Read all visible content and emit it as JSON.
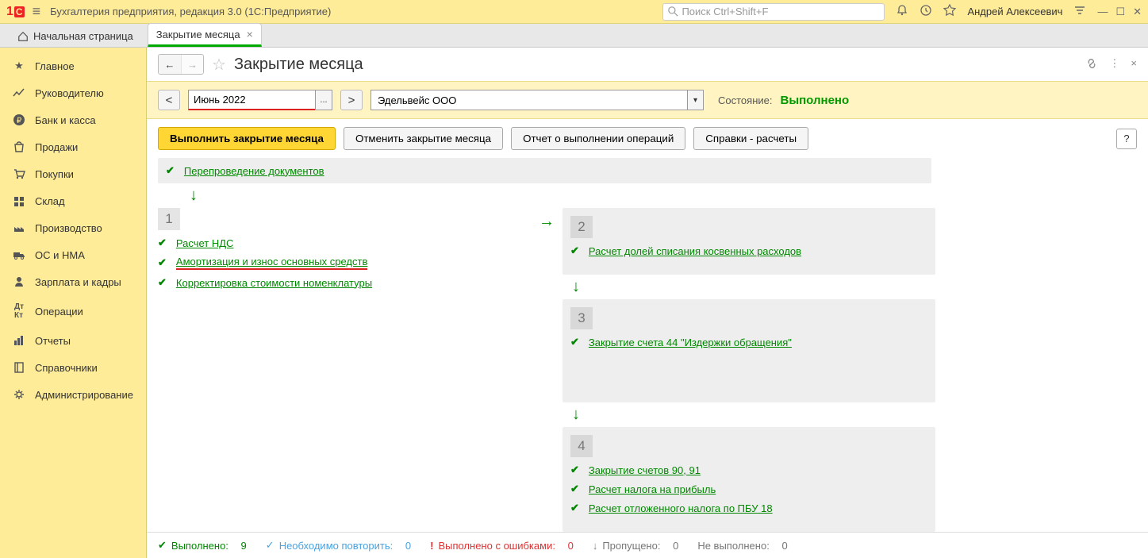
{
  "app_title": "Бухгалтерия предприятия, редакция 3.0  (1С:Предприятие)",
  "search_placeholder": "Поиск Ctrl+Shift+F",
  "user": "Андрей Алексеевич",
  "tabs": {
    "home": "Начальная страница",
    "active": "Закрытие месяца"
  },
  "sidebar": {
    "items": [
      {
        "label": "Главное"
      },
      {
        "label": "Руководителю"
      },
      {
        "label": "Банк и касса"
      },
      {
        "label": "Продажи"
      },
      {
        "label": "Покупки"
      },
      {
        "label": "Склад"
      },
      {
        "label": "Производство"
      },
      {
        "label": "ОС и НМА"
      },
      {
        "label": "Зарплата и кадры"
      },
      {
        "label": "Операции"
      },
      {
        "label": "Отчеты"
      },
      {
        "label": "Справочники"
      },
      {
        "label": "Администрирование"
      }
    ]
  },
  "page": {
    "title": "Закрытие месяца",
    "period": "Июнь 2022",
    "org": "Эдельвейс ООО",
    "state_label": "Состояние:",
    "state_value": "Выполнено"
  },
  "actions": {
    "run": "Выполнить закрытие месяца",
    "cancel": "Отменить закрытие месяца",
    "report": "Отчет о выполнении операций",
    "refs": "Справки - расчеты"
  },
  "ops": {
    "reproc": "Перепроведение документов",
    "b1": {
      "nds": "Расчет НДС",
      "amort": "Амортизация и износ основных средств",
      "korr": "Корректировка стоимости номенклатуры"
    },
    "b2": {
      "doli": "Расчет долей списания косвенных расходов"
    },
    "b3": {
      "acc44": "Закрытие счета 44 \"Издержки обращения\""
    },
    "b4": {
      "acc9091": "Закрытие счетов 90, 91",
      "tax": "Расчет налога на прибыль",
      "pbu18": "Расчет отложенного налога по ПБУ 18"
    }
  },
  "status": {
    "done_label": "Выполнено:",
    "done_count": "9",
    "repeat_label": "Необходимо повторить:",
    "repeat_count": "0",
    "err_label": "Выполнено с ошибками:",
    "err_count": "0",
    "skip_label": "Пропущено:",
    "skip_count": "0",
    "nexec_label": "Не выполнено:",
    "nexec_count": "0"
  }
}
